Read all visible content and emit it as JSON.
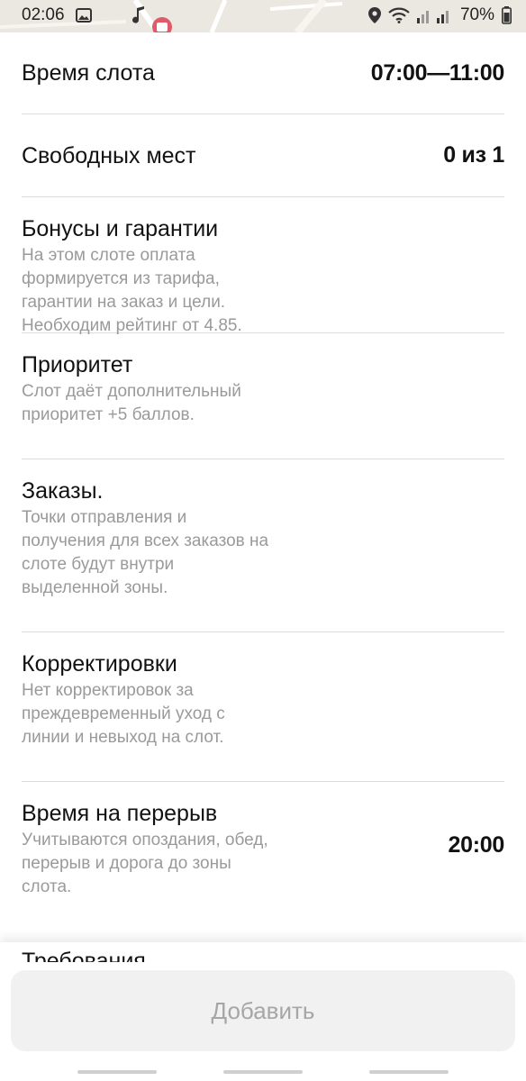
{
  "status_bar": {
    "time": "02:06",
    "battery": "70%",
    "icons": [
      "gallery-icon",
      "music-note-icon",
      "location-pin-icon",
      "wifi-icon",
      "signal-icon",
      "battery-icon"
    ]
  },
  "rows": {
    "slot_time": {
      "title": "Время слота",
      "value": "07:00—11:00"
    },
    "free_places": {
      "title": "Свободных мест",
      "value": "0 из 1"
    },
    "bonuses": {
      "title": "Бонусы и гарантии",
      "description": "На этом слоте оплата формируется из тарифа, гарантии на заказ и цели. Необходим рейтинг от 4.85."
    },
    "priority": {
      "title": "Приоритет",
      "description": "Слот даёт дополнительный приоритет +5 баллов."
    },
    "orders": {
      "title": "Заказы.",
      "description": "Точки отправления и получения для всех заказов на слоте будут внутри выделенной зоны."
    },
    "corrections": {
      "title": "Корректировки",
      "description": "Нет корректировок за преждевременный уход с линии и невыход на слот."
    },
    "break_time": {
      "title": "Время на перерыв",
      "description": "Учитываются опоздания, обед, перерыв и дорога до зоны слота.",
      "value": "20:00"
    }
  },
  "peek_row": {
    "title": "Требования"
  },
  "actions": {
    "add_label": "Добавить"
  },
  "colors": {
    "accent_disabled_bg": "#f1f1f1",
    "disabled_text": "#a6a6a6",
    "secondary_text": "#9a9a9a",
    "divider": "#dcdcdc"
  }
}
